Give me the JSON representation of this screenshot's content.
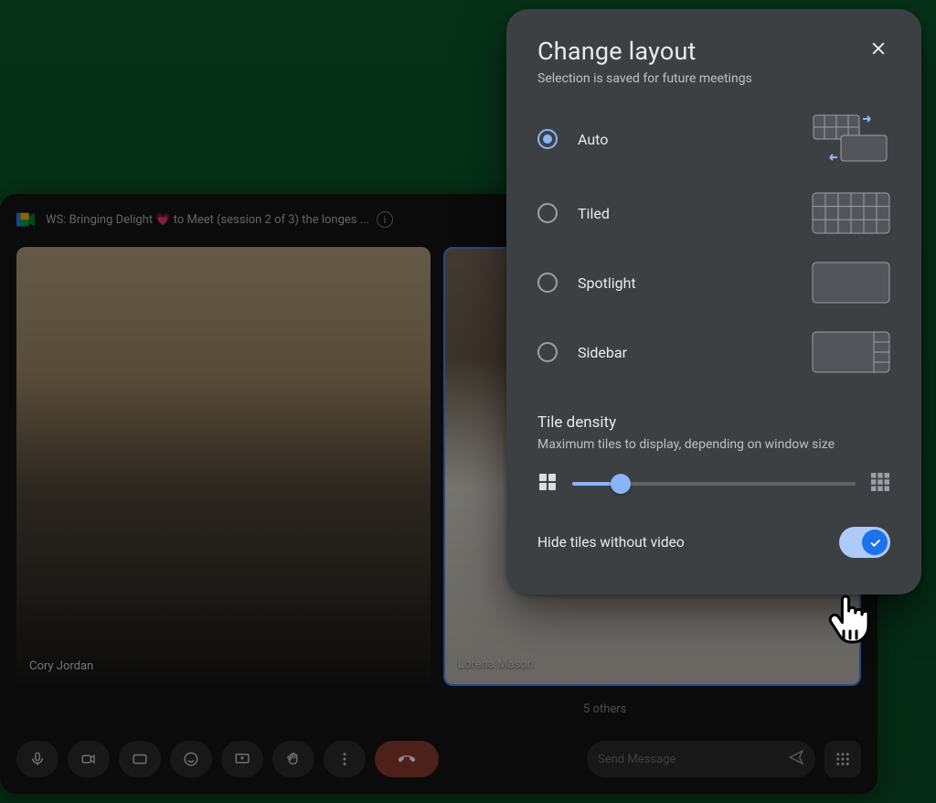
{
  "meet": {
    "title": "WS: Bringing Delight 💗 to Meet (session 2 of 3) the longes ...",
    "participants": [
      {
        "name": "Cory Jordan"
      },
      {
        "name": "Lorena Mason"
      }
    ],
    "others_label": "5 others",
    "send_placeholder": "Send Message"
  },
  "dialog": {
    "title": "Change layout",
    "subtitle": "Selection is saved for future meetings",
    "options": [
      {
        "key": "auto",
        "label": "Auto",
        "selected": true
      },
      {
        "key": "tiled",
        "label": "Tiled",
        "selected": false
      },
      {
        "key": "spotlight",
        "label": "Spotlight",
        "selected": false
      },
      {
        "key": "sidebar",
        "label": "Sidebar",
        "selected": false
      }
    ],
    "density": {
      "title": "Tile density",
      "subtitle": "Maximum tiles to display, depending on window size",
      "value_pct": 17
    },
    "hide_tiles": {
      "label": "Hide tiles without video",
      "enabled": true
    }
  }
}
